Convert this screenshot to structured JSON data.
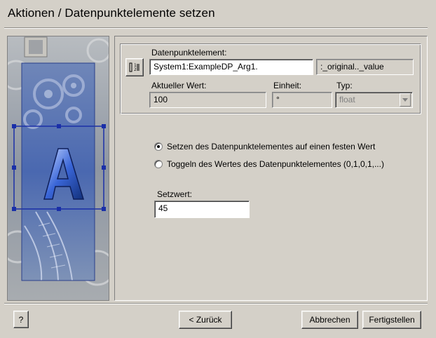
{
  "window": {
    "title": "Aktionen / Datenpunktelemente setzen"
  },
  "datapoint": {
    "label": "Datenpunktelement:",
    "value": "System1:ExampleDP_Arg1.",
    "config": ":_original.._value",
    "picker_icon": "datapoint-selector-icon"
  },
  "current": {
    "label": "Aktueller Wert:",
    "value": "100"
  },
  "unit": {
    "label": "Einheit:",
    "value": "°"
  },
  "type": {
    "label": "Typ:",
    "value": "float"
  },
  "options": [
    {
      "label": "Setzen des Datenpunktelementes auf einen festen Wert",
      "selected": true
    },
    {
      "label": "Toggeln des Wertes des Datenpunktelementes (0,1,0,1,...)",
      "selected": false
    }
  ],
  "setvalue": {
    "label": "Setzwert:",
    "value": "45"
  },
  "buttons": {
    "help": "?",
    "back": "< Zurück",
    "cancel": "Abbrechen",
    "finish": "Fertigstellen"
  },
  "colors": {
    "background": "#d4d0c8",
    "selection": "#1a2fa8"
  }
}
